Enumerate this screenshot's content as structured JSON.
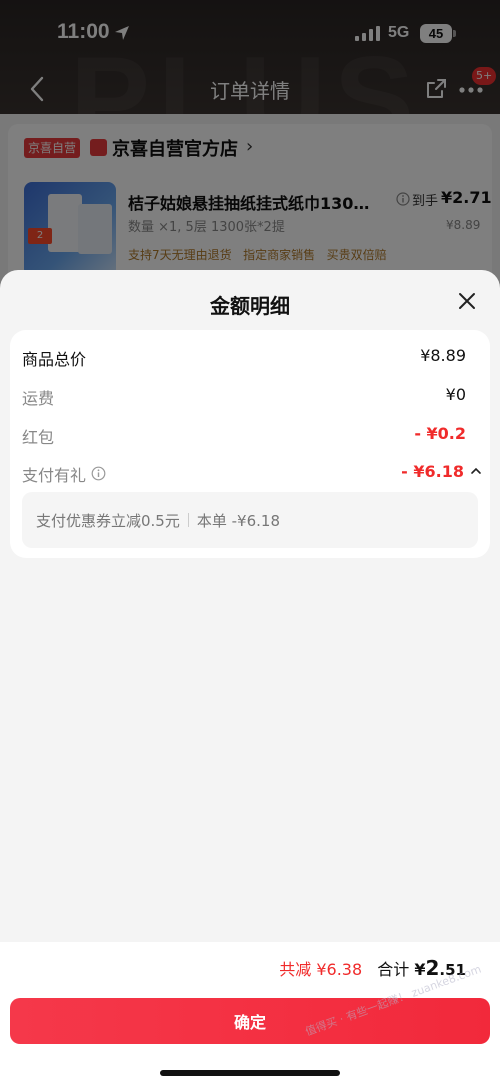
{
  "status_bar": {
    "time": "11:00",
    "network": "5G",
    "battery": "45"
  },
  "nav": {
    "title": "订单详情",
    "badge": "5+",
    "background_word": "PLUS"
  },
  "order": {
    "store_tag": "京喜自营",
    "store_name": "京喜自营官方店",
    "product_title": "桔子姑娘悬挂抽纸挂式纸巾130…",
    "product_spec": "数量 ×1, 5层 1300张*2提",
    "services": [
      "支持7天无理由退货",
      "指定商家销售",
      "买贵双倍赔"
    ],
    "arrive_label": "到手",
    "arrive_price": "¥2.71",
    "original_price": "¥8.89"
  },
  "sheet": {
    "title": "金额明细",
    "rows": [
      {
        "label": "商品总价",
        "value": "¥8.89"
      },
      {
        "label": "运费",
        "value": "¥0"
      },
      {
        "label": "红包",
        "value": "- ¥0.2"
      },
      {
        "label": "支付有礼",
        "value": "- ¥6.18"
      }
    ],
    "coupon": {
      "text": "支付优惠券立减0.5元",
      "order_text": "本单 -¥6.18"
    }
  },
  "footer": {
    "saving": "共减 ¥6.38",
    "total_label": "合计",
    "total_yen": "¥",
    "total_int": "2",
    "total_dec": ".51",
    "confirm": "确定",
    "watermark": "值得买 · 有些一起赚！ zuanke8.com"
  },
  "colors": {
    "accent_red": "#f02b2b",
    "button_red": "#f2293b",
    "header_dark": "#2a2524"
  },
  "icons": [
    "location-arrow-icon",
    "signal-icon",
    "battery-icon",
    "back-icon",
    "share-icon",
    "more-icon",
    "info-icon",
    "close-icon",
    "chevron-up-icon",
    "chevron-right-icon"
  ]
}
